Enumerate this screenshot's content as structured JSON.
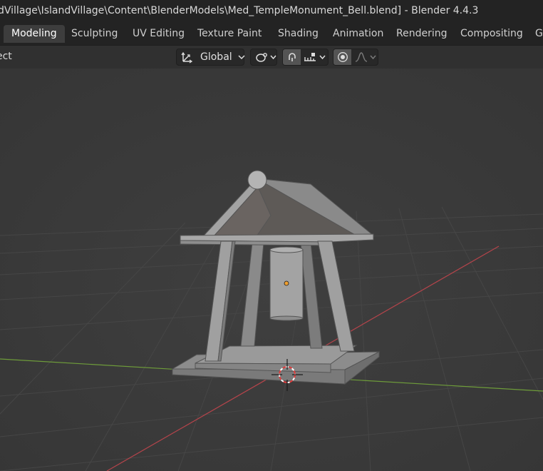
{
  "window": {
    "title": "dVillage\\IslandVillage\\Content\\BlenderModels\\Med_TempleMonument_Bell.blend] - Blender 4.4.3"
  },
  "workspace_tabs": [
    {
      "label": "Modeling",
      "active": true
    },
    {
      "label": "Sculpting",
      "active": false
    },
    {
      "label": "UV Editing",
      "active": false
    },
    {
      "label": "Texture Paint",
      "active": false
    },
    {
      "label": "Shading",
      "active": false
    },
    {
      "label": "Animation",
      "active": false
    },
    {
      "label": "Rendering",
      "active": false
    },
    {
      "label": "Compositing",
      "active": false
    },
    {
      "label": "Ge",
      "active": false
    }
  ],
  "viewport_header": {
    "left_menu": "ect",
    "transform_orientation": "Global",
    "pivot_icon": "pivot-point-icon",
    "snap_icon": "snap-magnet-icon",
    "snap_target_icon": "snap-increment-icon",
    "proportional_icon": "proportional-editing-icon",
    "falloff_icon": "falloff-curve-icon"
  },
  "colors": {
    "x_axis": "#b5444b",
    "y_axis": "#6e9c3a",
    "model": "#9a9a9a",
    "origin": "#f0a030"
  },
  "scene": {
    "object": "Med_TempleMonument_Bell"
  }
}
